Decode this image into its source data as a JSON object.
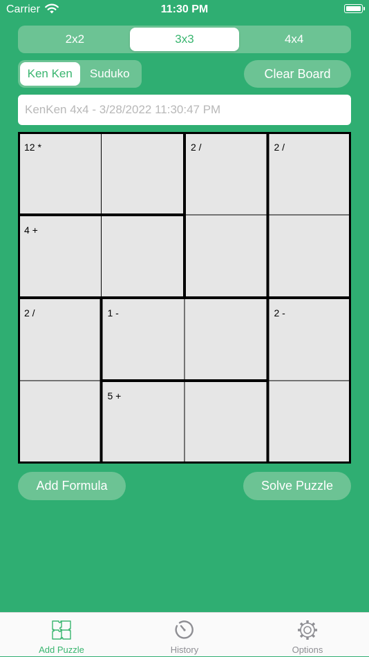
{
  "status_bar": {
    "carrier": "Carrier",
    "time": "11:30 PM"
  },
  "size_selector": {
    "options": [
      {
        "label": "2x2",
        "selected": false
      },
      {
        "label": "3x3",
        "selected": true
      },
      {
        "label": "4x4",
        "selected": false
      }
    ]
  },
  "puzzle_type": {
    "options": [
      {
        "label": "Ken Ken",
        "selected": true
      },
      {
        "label": "Suduko",
        "selected": false
      }
    ]
  },
  "clear_board_label": "Clear Board",
  "title_input": {
    "placeholder": "KenKen  4x4 - 3/28/2022 11:30:47 PM",
    "value": ""
  },
  "board": {
    "size": 4,
    "cages": [
      {
        "label": "12 *",
        "cells": [
          [
            0,
            0
          ],
          [
            0,
            1
          ]
        ]
      },
      {
        "label": "2 /",
        "cells": [
          [
            0,
            2
          ],
          [
            1,
            2
          ]
        ]
      },
      {
        "label": "2 /",
        "cells": [
          [
            0,
            3
          ],
          [
            1,
            3
          ]
        ]
      },
      {
        "label": "4 +",
        "cells": [
          [
            1,
            0
          ],
          [
            1,
            1
          ]
        ]
      },
      {
        "label": "2 /",
        "cells": [
          [
            2,
            0
          ],
          [
            3,
            0
          ]
        ]
      },
      {
        "label": "1 -",
        "cells": [
          [
            2,
            1
          ],
          [
            2,
            2
          ]
        ]
      },
      {
        "label": "2 -",
        "cells": [
          [
            2,
            3
          ],
          [
            3,
            3
          ]
        ]
      },
      {
        "label": "5 +",
        "cells": [
          [
            3,
            1
          ],
          [
            3,
            2
          ]
        ]
      }
    ]
  },
  "add_formula_label": "Add Formula",
  "solve_puzzle_label": "Solve Puzzle",
  "tab_bar": {
    "tabs": [
      {
        "label": "Add Puzzle",
        "icon": "puzzle-icon",
        "active": true
      },
      {
        "label": "History",
        "icon": "history-icon",
        "active": false
      },
      {
        "label": "Options",
        "icon": "gear-icon",
        "active": false
      }
    ]
  },
  "colors": {
    "background": "#2fae72",
    "accent": "#39b56f",
    "button": "#6cc394",
    "cell": "#e6e6e6"
  }
}
